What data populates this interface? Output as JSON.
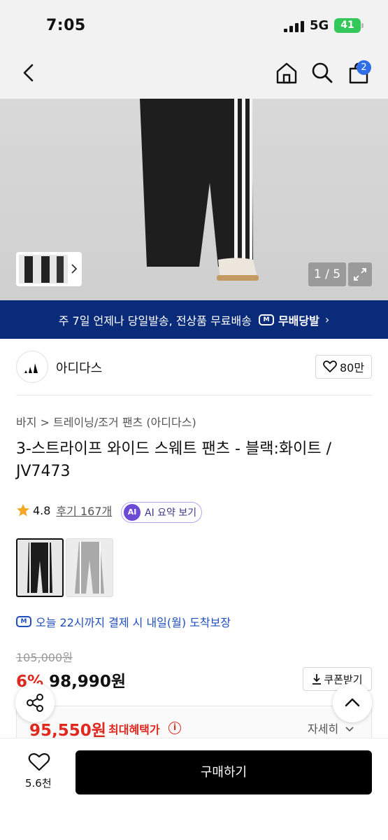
{
  "status_bar": {
    "time": "7:05",
    "network": "5G",
    "battery": "41"
  },
  "header": {
    "back_icon": "chevron-left-icon",
    "home_icon": "home-icon",
    "search_icon": "search-icon",
    "cart_icon": "shopping-bag-icon",
    "cart_count": "2"
  },
  "gallery": {
    "counter": "1 / 5",
    "expand_icon": "expand-icon"
  },
  "banner": {
    "text": "주 7일 언제나 당일발송, 전상품 무료배송",
    "brand": "무배당발",
    "chevron": "›"
  },
  "brand": {
    "name": "아디다스",
    "likes": "80만"
  },
  "product": {
    "breadcrumb": "바지 > 트레이닝/조거 팬츠 (아디다스)",
    "title": "3-스트라이프 와이드 스웨트 팬츠 - 블랙:화이트 / JV7473",
    "rating": "4.8",
    "reviews": "후기 167개",
    "ai_badge": "AI",
    "ai_summary": "AI 요약 보기"
  },
  "delivery": {
    "text": "오늘 22시까지 결제 시 내일(월) 도착보장"
  },
  "price": {
    "original": "105,000원",
    "discount": "6%",
    "sale": "98,990원",
    "coupon": "쿠폰받기",
    "max_price": "95,550원",
    "max_label": "최대혜택가",
    "detail": "자세히"
  },
  "bottom": {
    "wish_count": "5.6천",
    "buy": "구매하기"
  },
  "colors": {
    "banner": "#0a2a7a",
    "accent_red": "#e0281f",
    "link_blue": "#1f4fbf",
    "badge_blue": "#2f6ee8"
  }
}
